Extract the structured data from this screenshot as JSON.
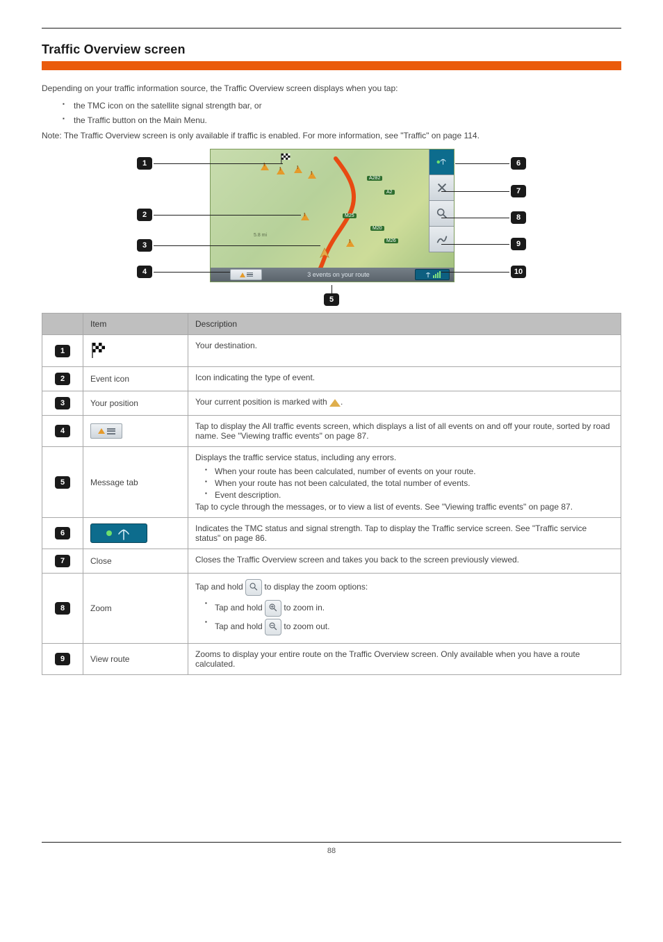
{
  "page": {
    "title": "Traffic Overview screen",
    "intro": "Depending on your traffic information source, the Traffic Overview screen displays when you tap:",
    "intro_items": [
      "the TMC icon on the satellite signal strength bar, or",
      "the Traffic button on the Main Menu."
    ],
    "note_prefix": "Note: ",
    "note_text": "The Traffic Overview screen is only available if traffic is enabled. For more information, see \"Traffic\" on page 114.",
    "page_number": "88"
  },
  "diagram": {
    "road_labels": [
      "A282",
      "A2",
      "M25",
      "M20",
      "M26"
    ],
    "distance_label": "5.8 mi",
    "bottom_bar_text": "3 events on your route",
    "callouts_left": [
      "1",
      "2",
      "3",
      "4"
    ],
    "callouts_right": [
      "6",
      "7",
      "8",
      "9",
      "10"
    ],
    "callout_bottom": "5"
  },
  "table": {
    "headers": [
      "",
      "Item",
      "Description"
    ],
    "rows": [
      {
        "num": "1",
        "item_type": "flag",
        "item_text": "",
        "desc_html": "Your destination."
      },
      {
        "num": "2",
        "item_type": "text",
        "item_text": "Event icon",
        "desc_html": "Icon indicating the type of event."
      },
      {
        "num": "3",
        "item_type": "text",
        "item_text": "Your position",
        "desc_html": "Your current position is marked with "
      },
      {
        "num": "4",
        "item_type": "evlist",
        "item_text": "",
        "desc_html": "Tap to display the All traffic events screen, which displays a list of all events on and off your route, sorted by road name. See \"Viewing traffic events\" on page 87."
      },
      {
        "num": "5",
        "item_type": "text",
        "item_text": "Message tab",
        "desc_pre": "Displays the traffic service status, including any errors.",
        "desc_list": [
          "When your route has been calculated, number of events on your route.",
          "When your route has not been calculated, the total number of events.",
          "Event description."
        ],
        "desc_post": "Tap to cycle through the messages, or to view a list of events. See \"Viewing traffic events\" on page 87."
      },
      {
        "num": "6",
        "item_type": "tmc",
        "item_text": "",
        "desc_html": "Indicates the TMC status and signal strength. Tap to display the Traffic service screen. See \"Traffic service status\" on page 86."
      },
      {
        "num": "7",
        "item_type": "text",
        "item_text": "Close",
        "desc_html": "Closes the Traffic Overview screen and takes you back to the screen previously viewed."
      },
      {
        "num": "8",
        "item_type": "text",
        "item_text": "Zoom",
        "desc_pre": "Tap and hold ",
        "desc_mid": " to display the zoom options:",
        "desc_list": [
          "Tap and hold __Z1__ to zoom in.",
          "Tap and hold __Z2__ to zoom out."
        ]
      },
      {
        "num": "9",
        "item_type": "text",
        "item_text": "View route",
        "desc_html": "Zooms to display your entire route on the Traffic Overview screen. Only available when you have a route calculated."
      }
    ]
  }
}
